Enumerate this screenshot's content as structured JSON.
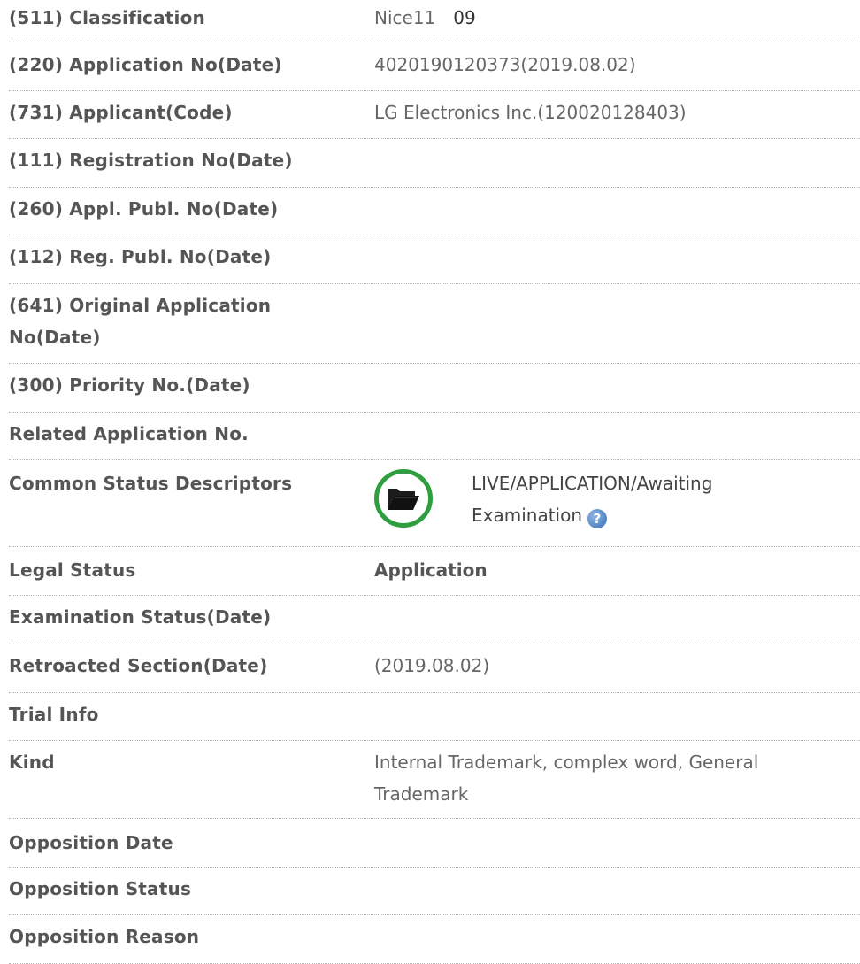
{
  "rows": {
    "classification": {
      "label": "(511) Classification",
      "value": "Nice11",
      "code": "09"
    },
    "application_no": {
      "label": "(220) Application No(Date)",
      "value": "4020190120373(2019.08.02)"
    },
    "applicant": {
      "label": "(731) Applicant(Code)",
      "value": "LG Electronics Inc.(120020128403)"
    },
    "registration_no": {
      "label": "(111) Registration No(Date)",
      "value": ""
    },
    "appl_publ_no": {
      "label": "(260) Appl. Publ. No(Date)",
      "value": ""
    },
    "reg_publ_no": {
      "label": "(112) Reg. Publ. No(Date)",
      "value": ""
    },
    "original_application": {
      "label_line1": "(641) Original Application",
      "label_line2": "No(Date)",
      "value": ""
    },
    "priority_no": {
      "label": "(300) Priority No.(Date)",
      "value": ""
    },
    "related_application": {
      "label": "Related Application No.",
      "value": ""
    },
    "common_status": {
      "label": "Common Status Descriptors",
      "status_line1": "LIVE/APPLICATION/Awaiting",
      "status_line2": "Examination",
      "help_glyph": "?",
      "icon": "folder-open-icon",
      "icon_color": "#2e9e3f"
    },
    "legal_status": {
      "label": "Legal Status",
      "value": "Application"
    },
    "examination_status": {
      "label": "Examination Status(Date)",
      "value": ""
    },
    "retroacted_section": {
      "label": "Retroacted Section(Date)",
      "value": "(2019.08.02)"
    },
    "trial_info": {
      "label": "Trial Info",
      "value": ""
    },
    "kind": {
      "label": "Kind",
      "value_line1": "Internal Trademark, complex word, General",
      "value_line2": "Trademark"
    },
    "opposition_date": {
      "label": "Opposition Date",
      "value": ""
    },
    "opposition_status": {
      "label": "Opposition Status",
      "value": ""
    },
    "opposition_reason": {
      "label": "Opposition Reason",
      "value": ""
    }
  }
}
